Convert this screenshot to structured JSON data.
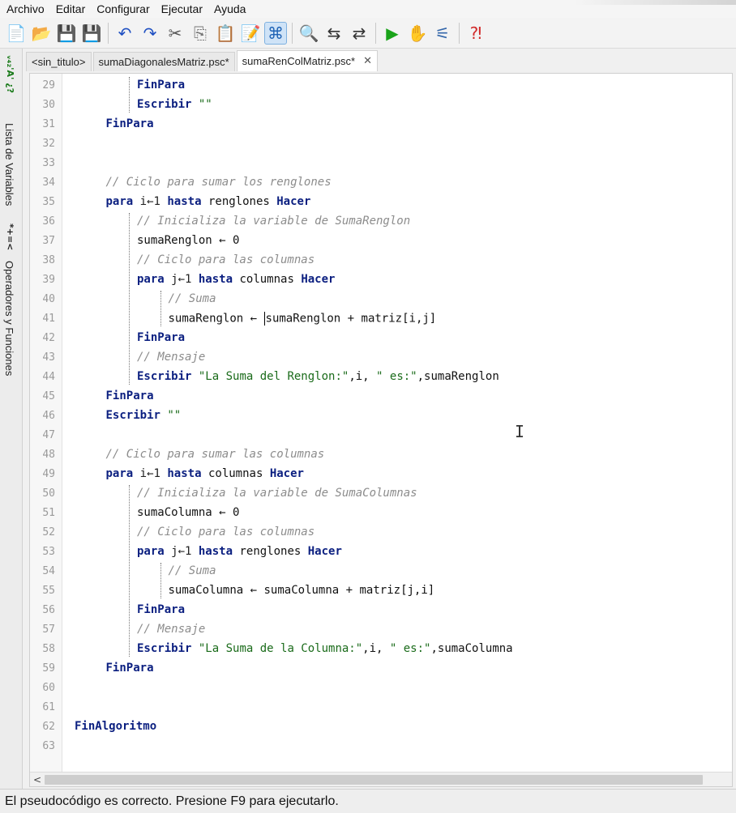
{
  "menu": [
    "Archivo",
    "Editar",
    "Configurar",
    "Ejecutar",
    "Ayuda"
  ],
  "toolbar": {
    "icons": [
      {
        "name": "new-file-icon",
        "glyph": "📄",
        "color": "#d9a520"
      },
      {
        "name": "open-folder-icon",
        "glyph": "📂",
        "color": "#c97b12"
      },
      {
        "name": "save-icon",
        "glyph": "💾",
        "color": "#b22222"
      },
      {
        "name": "save-as-icon",
        "glyph": "💾",
        "color": "#b22222"
      },
      {
        "sep": true
      },
      {
        "name": "undo-icon",
        "glyph": "↶",
        "color": "#1e4fc2"
      },
      {
        "name": "redo-icon",
        "glyph": "↷",
        "color": "#1e4fc2"
      },
      {
        "name": "cut-icon",
        "glyph": "✂",
        "color": "#555555"
      },
      {
        "name": "copy-icon",
        "glyph": "⎘",
        "color": "#777777"
      },
      {
        "name": "paste-icon",
        "glyph": "📋",
        "color": "#8a6d2b"
      },
      {
        "name": "edit-icon",
        "glyph": "📝",
        "color": "#777777"
      },
      {
        "name": "autocomplete-icon",
        "glyph": "⌘",
        "color": "#1f63b5",
        "active": true
      },
      {
        "sep": true
      },
      {
        "name": "find-icon",
        "glyph": "🔍",
        "color": "#333333"
      },
      {
        "name": "find-next-icon",
        "glyph": "⇆",
        "color": "#333333"
      },
      {
        "name": "replace-icon",
        "glyph": "⇄",
        "color": "#333333"
      },
      {
        "sep": true
      },
      {
        "name": "run-icon",
        "glyph": "▶",
        "color": "#1aa31a"
      },
      {
        "name": "step-icon",
        "glyph": "✋",
        "color": "#d2691e"
      },
      {
        "name": "flowchart-icon",
        "glyph": "⚟",
        "color": "#3366aa"
      },
      {
        "sep": true
      },
      {
        "name": "help-icon",
        "glyph": "⁈",
        "color": "#d12a2a"
      }
    ]
  },
  "side_tabs": {
    "variables_label": "Lista de Variables",
    "operators_label": "Operadores y Funciones"
  },
  "tabs": [
    {
      "label": "<sin_titulo>",
      "active": false
    },
    {
      "label": "sumaDiagonalesMatriz.psc*",
      "active": false
    },
    {
      "label": "sumaRenColMatriz.psc*",
      "active": true,
      "close": "✕"
    }
  ],
  "code_lines": [
    {
      "n": "29",
      "indent": 2,
      "tokens": [
        [
          "kw",
          "FinPara"
        ]
      ]
    },
    {
      "n": "30",
      "indent": 2,
      "tokens": [
        [
          "kw",
          "Escribir"
        ],
        [
          "op",
          " "
        ],
        [
          "str",
          "\"\""
        ]
      ]
    },
    {
      "n": "31",
      "indent": 1,
      "tokens": [
        [
          "kw",
          "FinPara"
        ]
      ]
    },
    {
      "n": "32",
      "indent": 0,
      "tokens": []
    },
    {
      "n": "33",
      "indent": 0,
      "tokens": []
    },
    {
      "n": "34",
      "indent": 1,
      "tokens": [
        [
          "cm",
          "// Ciclo para sumar los renglones"
        ]
      ]
    },
    {
      "n": "35",
      "indent": 1,
      "tokens": [
        [
          "kw",
          "para"
        ],
        [
          "op",
          " i←1 "
        ],
        [
          "kw",
          "hasta"
        ],
        [
          "id",
          " renglones "
        ],
        [
          "kw",
          "Hacer"
        ]
      ]
    },
    {
      "n": "36",
      "indent": 2,
      "tokens": [
        [
          "cm",
          "// Inicializa la variable de SumaRenglon"
        ]
      ]
    },
    {
      "n": "37",
      "indent": 2,
      "tokens": [
        [
          "id",
          "sumaRenglon ← 0"
        ]
      ]
    },
    {
      "n": "38",
      "indent": 2,
      "tokens": [
        [
          "cm",
          "// Ciclo para las columnas"
        ]
      ]
    },
    {
      "n": "39",
      "indent": 2,
      "tokens": [
        [
          "kw",
          "para"
        ],
        [
          "op",
          " j←1 "
        ],
        [
          "kw",
          "hasta"
        ],
        [
          "id",
          " columnas "
        ],
        [
          "kw",
          "Hacer"
        ]
      ]
    },
    {
      "n": "40",
      "indent": 3,
      "tokens": [
        [
          "cm",
          "// Suma"
        ]
      ]
    },
    {
      "n": "41",
      "indent": 3,
      "tokens": [
        [
          "id",
          "sumaRenglon ← "
        ],
        [
          "caret",
          ""
        ],
        [
          "id",
          "sumaRenglon + matriz[i,j]"
        ]
      ]
    },
    {
      "n": "42",
      "indent": 2,
      "tokens": [
        [
          "kw",
          "FinPara"
        ]
      ]
    },
    {
      "n": "43",
      "indent": 2,
      "tokens": [
        [
          "cm",
          "// Mensaje"
        ]
      ]
    },
    {
      "n": "44",
      "indent": 2,
      "tokens": [
        [
          "kw",
          "Escribir"
        ],
        [
          "op",
          " "
        ],
        [
          "str",
          "\"La Suma del Renglon:\""
        ],
        [
          "id",
          ",i, "
        ],
        [
          "str",
          "\" es:\""
        ],
        [
          "id",
          ",sumaRenglon"
        ]
      ]
    },
    {
      "n": "45",
      "indent": 1,
      "tokens": [
        [
          "kw",
          "FinPara"
        ]
      ]
    },
    {
      "n": "46",
      "indent": 1,
      "tokens": [
        [
          "kw",
          "Escribir"
        ],
        [
          "op",
          " "
        ],
        [
          "str",
          "\"\""
        ]
      ]
    },
    {
      "n": "47",
      "indent": 0,
      "tokens": []
    },
    {
      "n": "48",
      "indent": 1,
      "tokens": [
        [
          "cm",
          "// Ciclo para sumar las columnas"
        ]
      ]
    },
    {
      "n": "49",
      "indent": 1,
      "tokens": [
        [
          "kw",
          "para"
        ],
        [
          "op",
          " i←1 "
        ],
        [
          "kw",
          "hasta"
        ],
        [
          "id",
          " columnas "
        ],
        [
          "kw",
          "Hacer"
        ]
      ]
    },
    {
      "n": "50",
      "indent": 2,
      "tokens": [
        [
          "cm",
          "// Inicializa la variable de SumaColumnas"
        ]
      ]
    },
    {
      "n": "51",
      "indent": 2,
      "tokens": [
        [
          "id",
          "sumaColumna ← 0"
        ]
      ]
    },
    {
      "n": "52",
      "indent": 2,
      "tokens": [
        [
          "cm",
          "// Ciclo para las columnas"
        ]
      ]
    },
    {
      "n": "53",
      "indent": 2,
      "tokens": [
        [
          "kw",
          "para"
        ],
        [
          "op",
          " j←1 "
        ],
        [
          "kw",
          "hasta"
        ],
        [
          "id",
          " renglones "
        ],
        [
          "kw",
          "Hacer"
        ]
      ]
    },
    {
      "n": "54",
      "indent": 3,
      "tokens": [
        [
          "cm",
          "// Suma"
        ]
      ]
    },
    {
      "n": "55",
      "indent": 3,
      "tokens": [
        [
          "id",
          "sumaColumna ← sumaColumna + matriz[j,i]"
        ]
      ]
    },
    {
      "n": "56",
      "indent": 2,
      "tokens": [
        [
          "kw",
          "FinPara"
        ]
      ]
    },
    {
      "n": "57",
      "indent": 2,
      "tokens": [
        [
          "cm",
          "// Mensaje"
        ]
      ]
    },
    {
      "n": "58",
      "indent": 2,
      "tokens": [
        [
          "kw",
          "Escribir"
        ],
        [
          "op",
          " "
        ],
        [
          "str",
          "\"La Suma de la Columna:\""
        ],
        [
          "id",
          ",i, "
        ],
        [
          "str",
          "\" es:\""
        ],
        [
          "id",
          ",sumaColumna"
        ]
      ]
    },
    {
      "n": "59",
      "indent": 1,
      "tokens": [
        [
          "kw",
          "FinPara"
        ]
      ]
    },
    {
      "n": "60",
      "indent": 0,
      "tokens": []
    },
    {
      "n": "61",
      "indent": 0,
      "tokens": []
    },
    {
      "n": "62",
      "indent": 0,
      "tokens": [
        [
          "kw",
          "FinAlgoritmo"
        ]
      ]
    },
    {
      "n": "63",
      "indent": 0,
      "tokens": []
    }
  ],
  "status": "El pseudocódigo es correcto. Presione F9 para ejecutarlo.",
  "colors": {
    "keyword": "#0b1f80",
    "comment": "#8c8c8c",
    "string": "#1a6b1a"
  }
}
